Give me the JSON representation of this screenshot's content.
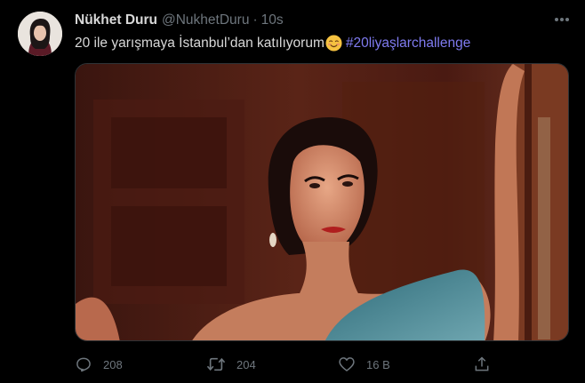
{
  "tweet": {
    "display_name": "Nükhet Duru",
    "handle": "@NukhetDuru",
    "separator": "·",
    "time": "10s",
    "text": "20 ile yarışmaya İstanbul’dan katılıyorum",
    "hashtag": "#20liyaşlarchallenge",
    "emoji": "smiling-face-emoji"
  },
  "actions": {
    "reply_count": "208",
    "retweet_count": "204",
    "like_count": "16 B"
  },
  "icons": {
    "reply": "reply-icon",
    "retweet": "retweet-icon",
    "like": "heart-icon",
    "share": "share-icon",
    "more": "more-icon"
  },
  "colors": {
    "background": "#000000",
    "text": "#d9d9d9",
    "muted": "#6e767d",
    "hashtag": "#7f7bf0"
  }
}
